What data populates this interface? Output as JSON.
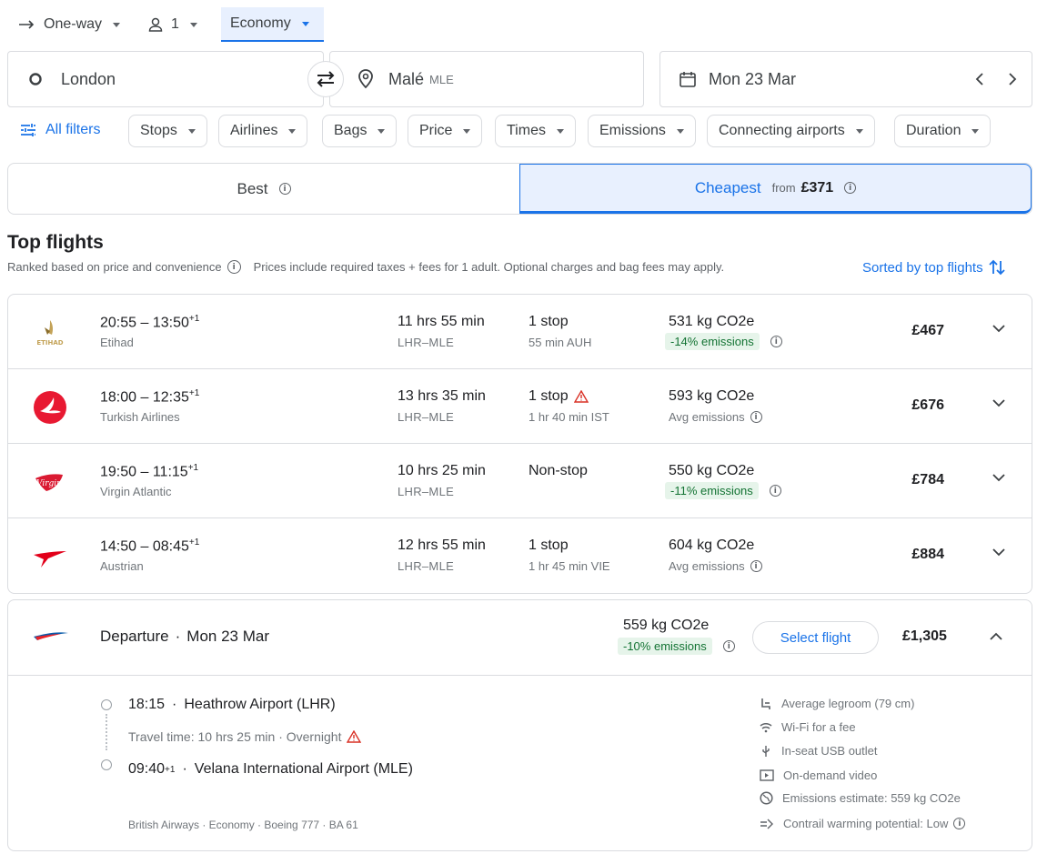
{
  "search": {
    "trip_type": "One-way",
    "passengers": "1",
    "cabin_class": "Economy",
    "origin": "London",
    "destination": "Malé",
    "destination_code": "MLE",
    "date": "Mon 23 Mar"
  },
  "filters": {
    "all_filters": "All filters",
    "chips": [
      "Stops",
      "Airlines",
      "Bags",
      "Price",
      "Times",
      "Emissions",
      "Connecting airports",
      "Duration"
    ]
  },
  "tabs": {
    "best": "Best",
    "cheapest": "Cheapest",
    "cheapest_from": "from",
    "cheapest_price": "£371"
  },
  "results": {
    "title": "Top flights",
    "subtitle": "Ranked based on price and convenience",
    "note": "Prices include required taxes + fees for 1 adult. Optional charges and bag fees may apply.",
    "sort_label": "Sorted by top flights"
  },
  "flights": [
    {
      "time": "20:55 – 13:50",
      "plus": "+1",
      "airline": "Etihad",
      "duration": "11 hrs 55 min",
      "route": "LHR–MLE",
      "stops": "1 stop",
      "stop_detail": "55 min AUH",
      "co2": "531 kg CO2e",
      "emissions": "-14% emissions",
      "price": "£467"
    },
    {
      "time": "18:00 – 12:35",
      "plus": "+1",
      "airline": "Turkish Airlines",
      "duration": "13 hrs 35 min",
      "route": "LHR–MLE",
      "stops": "1 stop",
      "stop_detail": "1 hr 40 min IST",
      "co2": "593 kg CO2e",
      "emissions": "Avg emissions",
      "price": "£676"
    },
    {
      "time": "19:50 – 11:15",
      "plus": "+1",
      "airline": "Virgin Atlantic",
      "duration": "10 hrs 25 min",
      "route": "LHR–MLE",
      "stops": "Non-stop",
      "stop_detail": "",
      "co2": "550 kg CO2e",
      "emissions": "-11% emissions",
      "price": "£784"
    },
    {
      "time": "14:50 – 08:45",
      "plus": "+1",
      "airline": "Austrian",
      "duration": "12 hrs 55 min",
      "route": "LHR–MLE",
      "stops": "1 stop",
      "stop_detail": "1 hr 45 min VIE",
      "co2": "604 kg CO2e",
      "emissions": "Avg emissions",
      "price": "£884"
    }
  ],
  "expanded": {
    "departure_label": "Departure",
    "date": "Mon 23 Mar",
    "co2": "559 kg CO2e",
    "emissions": "-10% emissions",
    "select_button": "Select flight",
    "price": "£1,305",
    "depart_time": "18:15",
    "depart_airport": "Heathrow Airport (LHR)",
    "travel_time": "Travel time: 10 hrs 25 min · Overnight",
    "arrive_time": "09:40",
    "arrive_plus": "+1",
    "arrive_airport": "Velana International Airport (MLE)",
    "flight_info": "British Airways · Economy · Boeing 777 · BA 61",
    "amenities": [
      {
        "icon": "legroom-icon",
        "text": "Average legroom (79 cm)"
      },
      {
        "icon": "wifi-icon",
        "text": "Wi-Fi for a fee"
      },
      {
        "icon": "usb-icon",
        "text": "In-seat USB outlet"
      },
      {
        "icon": "video-icon",
        "text": "On-demand video"
      },
      {
        "icon": "globe-icon",
        "text": "Emissions estimate: 559 kg CO2e"
      },
      {
        "icon": "contrail-icon",
        "text": "Contrail warming potential: Low"
      }
    ]
  },
  "colors": {
    "accent": "#1a73e8",
    "active_tab_bg": "#e8f0fe",
    "emission_badge_bg": "#e6f4ea",
    "emission_badge_text": "#137333",
    "warning": "#d93025"
  }
}
